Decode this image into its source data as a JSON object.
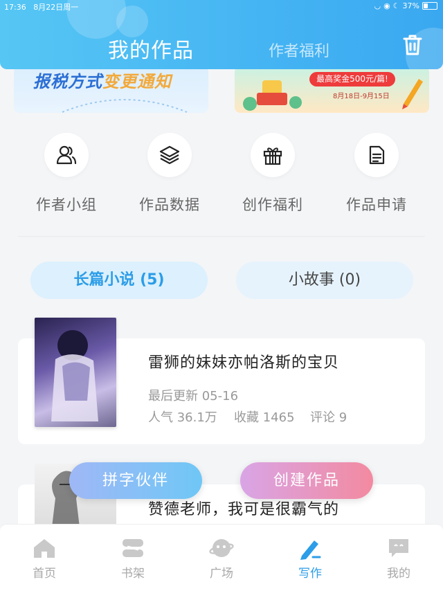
{
  "status_bar": {
    "time": "17:36",
    "date": "8月22日周一",
    "battery": "37%",
    "battery_level": 0.37
  },
  "header": {
    "tab_works": "我的作品",
    "tab_welfare": "作者福利",
    "trash_icon": "trash-icon"
  },
  "banners": {
    "left": {
      "text_main": "报税方式",
      "text_emphasis": "变更通知"
    },
    "right": {
      "prize": "最高奖金500元/篇!",
      "dates": "8月18日-9月15日"
    }
  },
  "actions": [
    {
      "label": "作者小组",
      "icon": "group-icon"
    },
    {
      "label": "作品数据",
      "icon": "layers-icon"
    },
    {
      "label": "创作福利",
      "icon": "gift-icon"
    },
    {
      "label": "作品申请",
      "icon": "document-icon"
    }
  ],
  "segments": {
    "novel": "长篇小说 (5)",
    "story": "小故事 (0)"
  },
  "books": [
    {
      "title": "雷狮的妹妹亦帕洛斯的宝贝",
      "updated": "最后更新 05-16",
      "popularity": "人气 36.1万",
      "favorites": "收藏 1465",
      "comments": "评论 9"
    },
    {
      "title": "赞德老师，我可是很霸气的"
    }
  ],
  "floating": {
    "partner": "拼字伙伴",
    "create": "创建作品"
  },
  "nav": [
    {
      "label": "首页",
      "icon": "home-icon"
    },
    {
      "label": "书架",
      "icon": "bookshelf-icon"
    },
    {
      "label": "广场",
      "icon": "planet-icon"
    },
    {
      "label": "写作",
      "icon": "pen-icon"
    },
    {
      "label": "我的",
      "icon": "chat-bubble-icon"
    }
  ],
  "colors": {
    "accent": "#2c9de8",
    "header": "#45b4f3",
    "create": "#f38aa0",
    "partner": "#6fc7f6"
  }
}
